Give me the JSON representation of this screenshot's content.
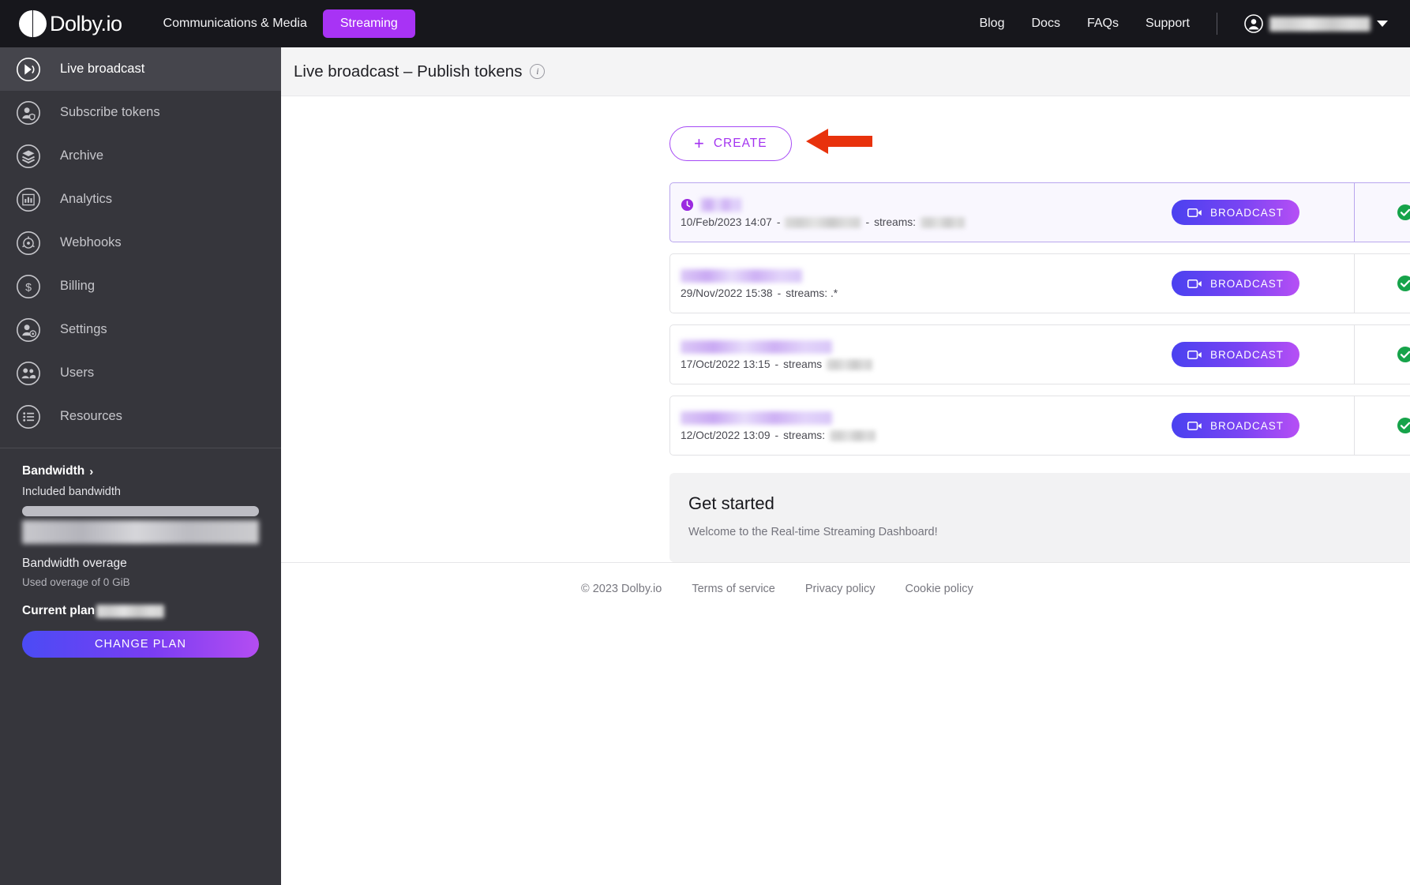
{
  "topnav": {
    "brand": "Dolby.io",
    "product_label": "Communications & Media",
    "active_pill": "Streaming",
    "links": [
      "Blog",
      "Docs",
      "FAQs",
      "Support"
    ],
    "account_name_redacted": "",
    "accent_purple": "#a833f5"
  },
  "sidebar": {
    "items": [
      {
        "label": "Live broadcast",
        "icon": "broadcast-icon",
        "active": true
      },
      {
        "label": "Subscribe tokens",
        "icon": "subscriber-icon",
        "active": false
      },
      {
        "label": "Archive",
        "icon": "layers-icon",
        "active": false
      },
      {
        "label": "Analytics",
        "icon": "chart-icon",
        "active": false
      },
      {
        "label": "Webhooks",
        "icon": "webhook-icon",
        "active": false
      },
      {
        "label": "Billing",
        "icon": "dollar-icon",
        "active": false
      },
      {
        "label": "Settings",
        "icon": "user-gear-icon",
        "active": false
      },
      {
        "label": "Users",
        "icon": "users-icon",
        "active": false
      },
      {
        "label": "Resources",
        "icon": "list-icon",
        "active": false
      }
    ],
    "bandwidth": {
      "title": "Bandwidth",
      "chevron": "›",
      "included_label": "Included bandwidth",
      "usage_redacted": "",
      "overage_title": "Bandwidth overage",
      "overage_sub": "Used overage of 0 GiB",
      "plan_label": "Current plan",
      "plan_value_redacted": "",
      "change_plan_button": "CHANGE PLAN"
    }
  },
  "page": {
    "title": "Live broadcast – Publish tokens",
    "info_icon": "i",
    "create_button": "CREATE",
    "create_plus": "+"
  },
  "tokens": [
    {
      "name_redacted": "",
      "name_blur_width": 52,
      "date": "10/Feb/2023 14:07",
      "sep1": "-",
      "detail_redacted": "",
      "detail_blur_width": 96,
      "sep2": "-",
      "streams_label": "streams:",
      "streams_redacted": "",
      "streams_blur_width": 56,
      "broadcast_button": "BROADCAST",
      "status": "active",
      "selected": true
    },
    {
      "name_redacted": "",
      "name_blur_width": 154,
      "date": "29/Nov/2022 15:38",
      "sep1": "-",
      "detail_redacted": null,
      "detail_blur_width": 0,
      "sep2": "",
      "streams_label": "streams: .*",
      "streams_redacted": null,
      "streams_blur_width": 0,
      "broadcast_button": "BROADCAST",
      "status": "active",
      "selected": false
    },
    {
      "name_redacted": "",
      "name_blur_width": 192,
      "date": "17/Oct/2022 13:15",
      "sep1": "-",
      "detail_redacted": null,
      "detail_blur_width": 0,
      "sep2": "",
      "streams_label": "streams",
      "streams_redacted": "",
      "streams_blur_width": 58,
      "broadcast_button": "BROADCAST",
      "status": "active",
      "selected": false
    },
    {
      "name_redacted": "",
      "name_blur_width": 192,
      "date": "12/Oct/2022 13:09",
      "sep1": "-",
      "detail_redacted": null,
      "detail_blur_width": 0,
      "sep2": "",
      "streams_label": "streams:",
      "streams_redacted": "",
      "streams_blur_width": 58,
      "broadcast_button": "BROADCAST",
      "status": "active",
      "selected": false
    }
  ],
  "get_started": {
    "title": "Get started",
    "subtitle": "Welcome to the Real-time Streaming Dashboard!"
  },
  "footer": {
    "copyright": "© 2023 Dolby.io",
    "links": [
      "Terms of service",
      "Privacy policy",
      "Cookie policy"
    ]
  },
  "annotation": {
    "arrow_color": "#e8320c",
    "arrow_target": "create-button"
  },
  "colors": {
    "status_green": "#16a34a",
    "brand_purple": "#a833f5",
    "sidebar_bg": "#36363c",
    "topnav_bg": "#17171c"
  }
}
